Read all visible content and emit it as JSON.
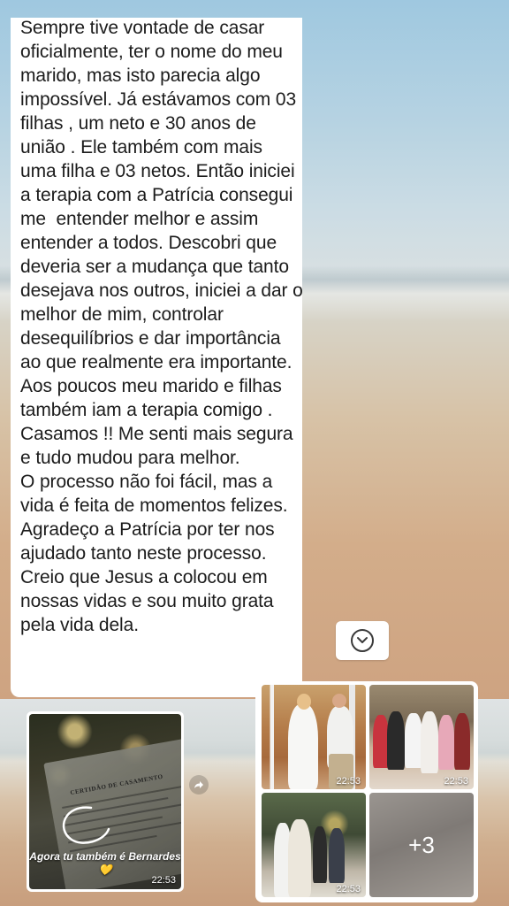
{
  "message": {
    "text": "Sempre tive vontade de casar oficialmente, ter o nome do meu marido, mas isto parecia algo impossível. Já estávamos com 03 filhas , um neto e 30 anos de união . Ele também com mais uma filha e 03 netos. Então iniciei a terapia com a Patrícia consegui me  entender melhor e assim entender a todos. Descobri que deveria ser a mudança que tanto desejava nos outros, iniciei a dar o melhor de mim, controlar desequilíbrios e dar importância ao que realmente era importante.  Aos poucos meu marido e filhas também iam a terapia comigo .  Casamos !! Me senti mais segura e tudo mudou para melhor.\nO processo não foi fácil, mas a vida é feita de momentos felizes.  Agradeço a Patrícia por ter nos ajudado tanto neste processo. Creio que Jesus a colocou em nossas vidas e sou muito grata pela vida dela."
  },
  "image_message": {
    "certificate_title": "CERTIDÃO DE CASAMENTO",
    "caption": "Agora tu também é Bernardes 💛",
    "time": "22:53"
  },
  "album": {
    "photos": [
      {
        "time": "22:53"
      },
      {
        "time": "22:53"
      },
      {
        "time": "22:53"
      },
      {
        "more_label": "+3"
      }
    ]
  },
  "icons": {
    "scroll_down": "chevron-down-circle-icon",
    "forward": "forward-icon"
  }
}
